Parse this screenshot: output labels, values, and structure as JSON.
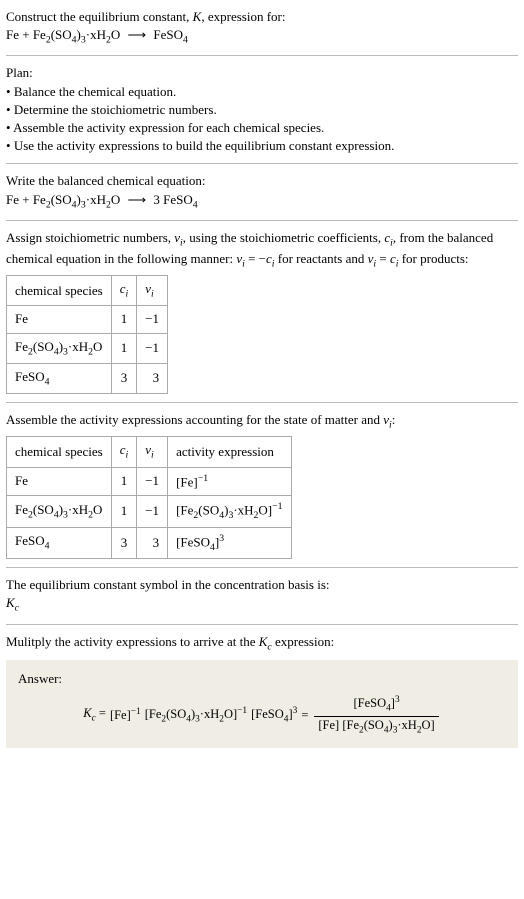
{
  "header": {
    "line1": "Construct the equilibrium constant, K, expression for:",
    "equation_unbalanced": "Fe + Fe₂(SO₄)₃·xH₂O ⟶ FeSO₄"
  },
  "plan": {
    "title": "Plan:",
    "items": [
      "Balance the chemical equation.",
      "Determine the stoichiometric numbers.",
      "Assemble the activity expression for each chemical species.",
      "Use the activity expressions to build the equilibrium constant expression."
    ]
  },
  "balanced": {
    "title": "Write the balanced chemical equation:",
    "equation": "Fe + Fe₂(SO₄)₃·xH₂O ⟶ 3 FeSO₄"
  },
  "stoich": {
    "intro": "Assign stoichiometric numbers, νᵢ, using the stoichiometric coefficients, cᵢ, from the balanced chemical equation in the following manner: νᵢ = −cᵢ for reactants and νᵢ = cᵢ for products:",
    "headers": {
      "species": "chemical species",
      "ci": "cᵢ",
      "vi": "νᵢ"
    },
    "rows": [
      {
        "species": "Fe",
        "ci": "1",
        "vi": "−1"
      },
      {
        "species": "Fe₂(SO₄)₃·xH₂O",
        "ci": "1",
        "vi": "−1"
      },
      {
        "species": "FeSO₄",
        "ci": "3",
        "vi": "3"
      }
    ]
  },
  "activity": {
    "intro": "Assemble the activity expressions accounting for the state of matter and νᵢ:",
    "headers": {
      "species": "chemical species",
      "ci": "cᵢ",
      "vi": "νᵢ",
      "expr": "activity expression"
    },
    "rows": [
      {
        "species": "Fe",
        "ci": "1",
        "vi": "−1",
        "expr": "[Fe]⁻¹"
      },
      {
        "species": "Fe₂(SO₄)₃·xH₂O",
        "ci": "1",
        "vi": "−1",
        "expr": "[Fe₂(SO₄)₃·xH₂O]⁻¹"
      },
      {
        "species": "FeSO₄",
        "ci": "3",
        "vi": "3",
        "expr": "[FeSO₄]³"
      }
    ]
  },
  "symbol": {
    "line1": "The equilibrium constant symbol in the concentration basis is:",
    "line2": "K_c"
  },
  "multiply": {
    "intro": "Mulitply the activity expressions to arrive at the K_c expression:"
  },
  "answer": {
    "label": "Answer:",
    "lhs": "K_c =",
    "term1": "[Fe]⁻¹",
    "term2": "[Fe₂(SO₄)₃·xH₂O]⁻¹",
    "term3": "[FeSO₄]³",
    "eq": "=",
    "frac_num": "[FeSO₄]³",
    "frac_den": "[Fe] [Fe₂(SO₄)₃·xH₂O]"
  },
  "chart_data": {
    "type": "table",
    "tables": [
      {
        "title": "Stoichiometric numbers",
        "columns": [
          "chemical species",
          "c_i",
          "ν_i"
        ],
        "rows": [
          [
            "Fe",
            1,
            -1
          ],
          [
            "Fe2(SO4)3·xH2O",
            1,
            -1
          ],
          [
            "FeSO4",
            3,
            3
          ]
        ]
      },
      {
        "title": "Activity expressions",
        "columns": [
          "chemical species",
          "c_i",
          "ν_i",
          "activity expression"
        ],
        "rows": [
          [
            "Fe",
            1,
            -1,
            "[Fe]^-1"
          ],
          [
            "Fe2(SO4)3·xH2O",
            1,
            -1,
            "[Fe2(SO4)3·xH2O]^-1"
          ],
          [
            "FeSO4",
            3,
            3,
            "[FeSO4]^3"
          ]
        ]
      }
    ],
    "equilibrium_constant": "K_c = [FeSO4]^3 / ([Fe] [Fe2(SO4)3·xH2O])"
  }
}
